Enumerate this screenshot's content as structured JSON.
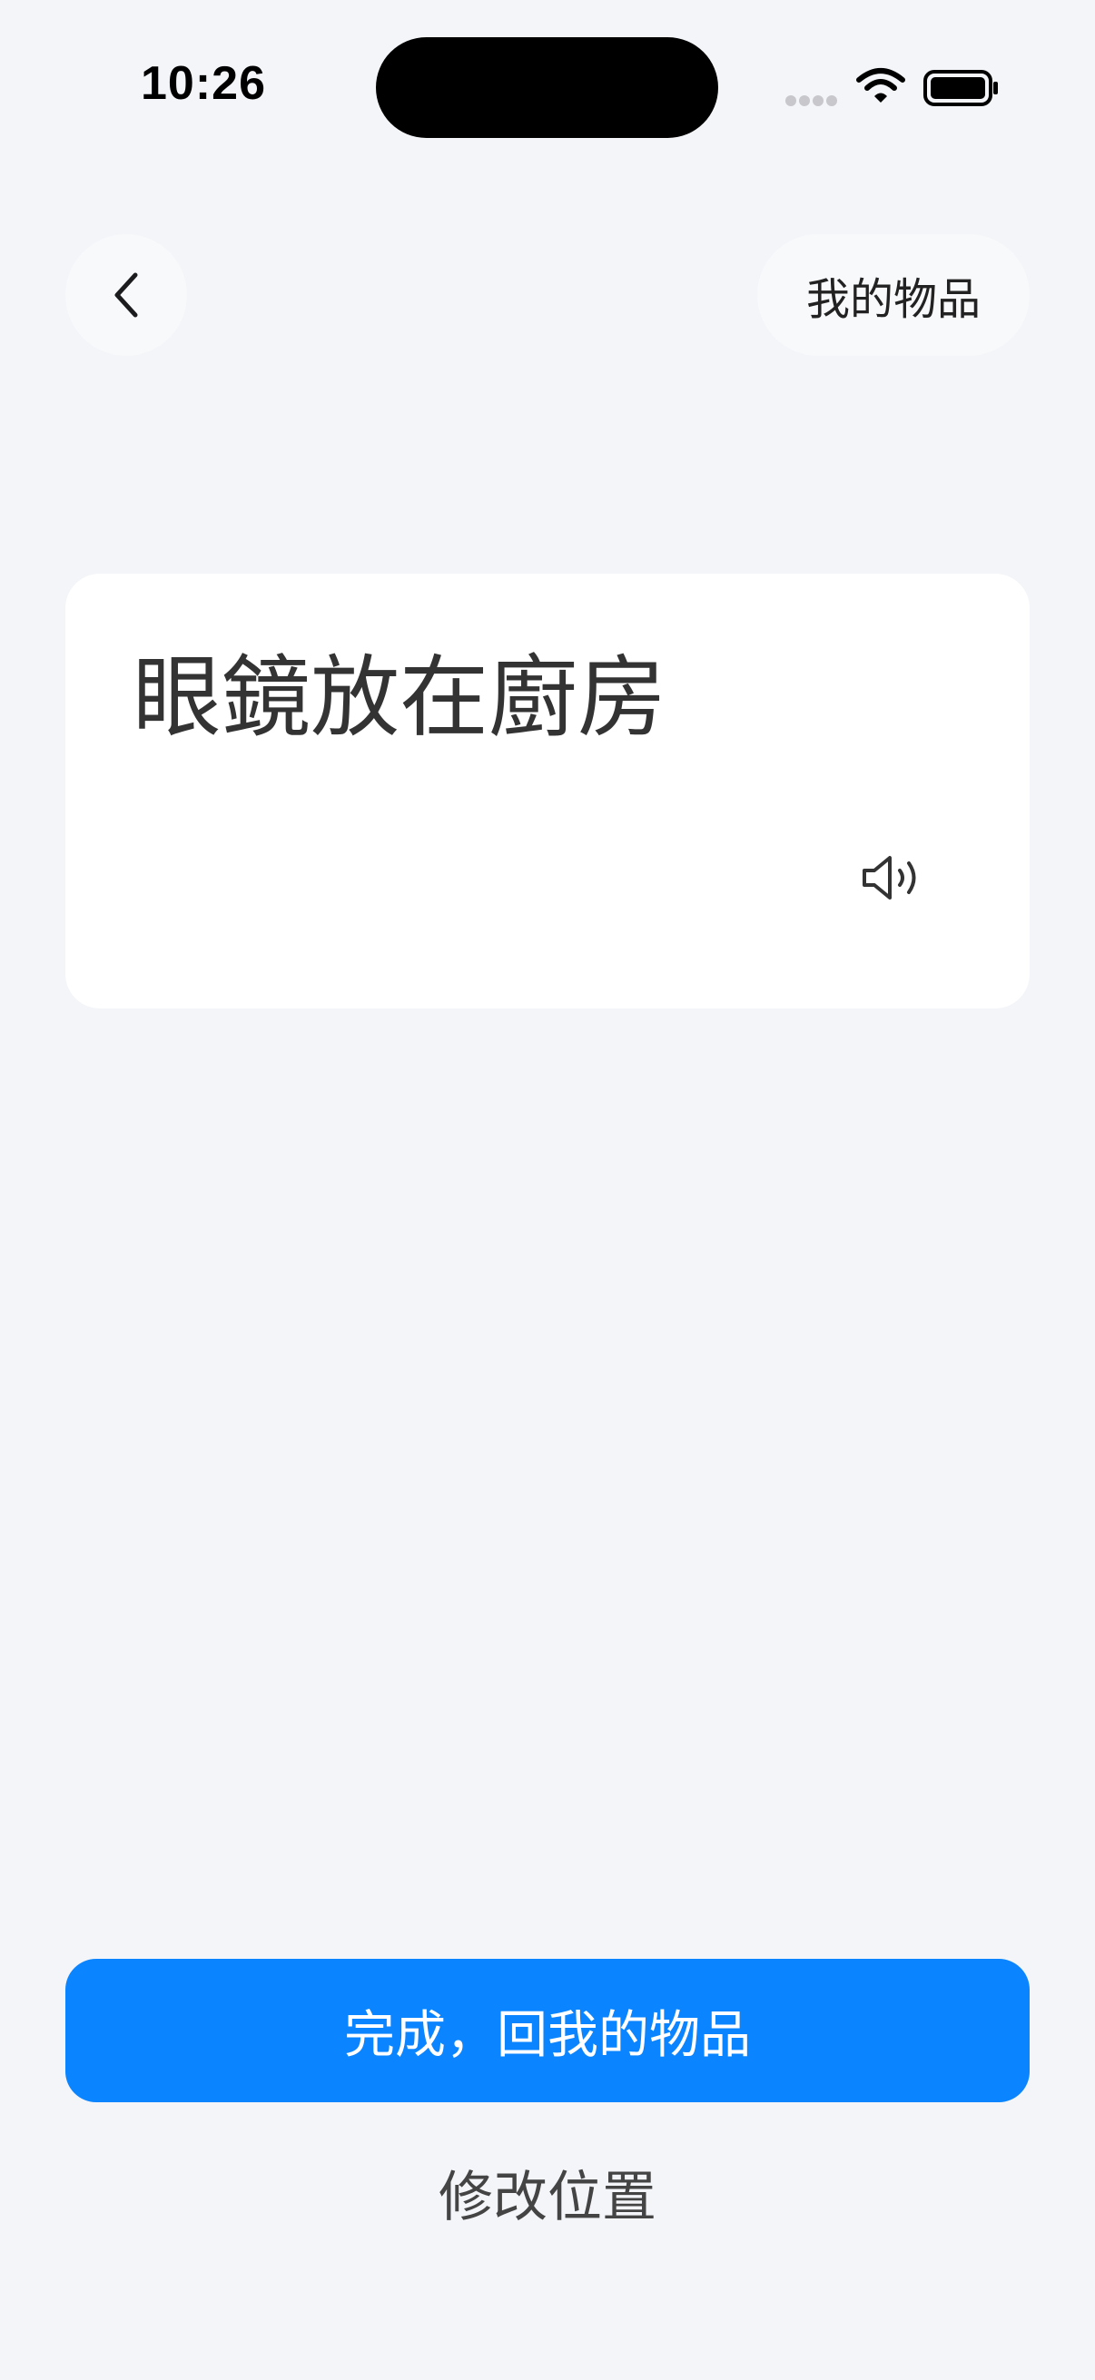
{
  "status_bar": {
    "time": "10:26"
  },
  "header": {
    "back_icon": "chevron-left-icon",
    "my_items_label": "我的物品"
  },
  "card": {
    "title": "眼鏡放在廚房",
    "speaker_icon": "speaker-icon"
  },
  "actions": {
    "primary_label": "完成，回我的物品",
    "secondary_label": "修改位置"
  },
  "colors": {
    "background": "#f3f5f9",
    "card": "#ffffff",
    "primary": "#0a84ff",
    "text": "#333333"
  }
}
